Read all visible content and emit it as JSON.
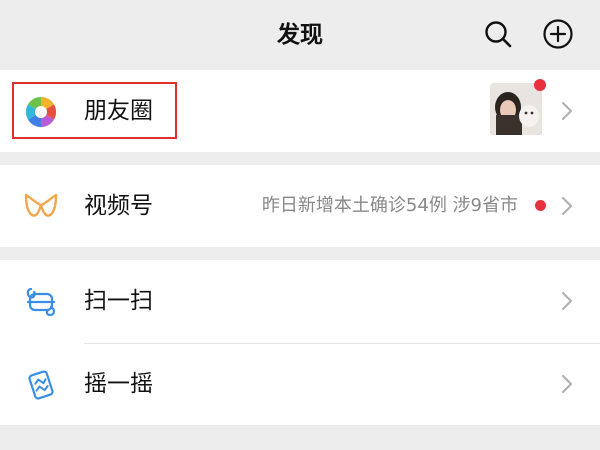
{
  "header": {
    "title": "发现",
    "search_icon": "search-icon",
    "add_icon": "plus-circle-icon"
  },
  "menu": {
    "moments": {
      "label": "朋友圈",
      "icon": "moments-aperture-icon",
      "has_new_dot": true
    },
    "channels": {
      "label": "视频号",
      "icon": "channels-icon",
      "notice": "昨日新增本土确诊54例 涉9省市",
      "has_new_dot": true
    },
    "scan": {
      "label": "扫一扫",
      "icon": "scan-icon"
    },
    "shake": {
      "label": "摇一摇",
      "icon": "shake-icon"
    }
  },
  "colors": {
    "background": "#ededed",
    "row_background": "#ffffff",
    "badge_red": "#e9303d",
    "highlight_border": "#e0302b",
    "icon_blue": "#3a8ee6",
    "channels_orange": "#f2a64c"
  }
}
